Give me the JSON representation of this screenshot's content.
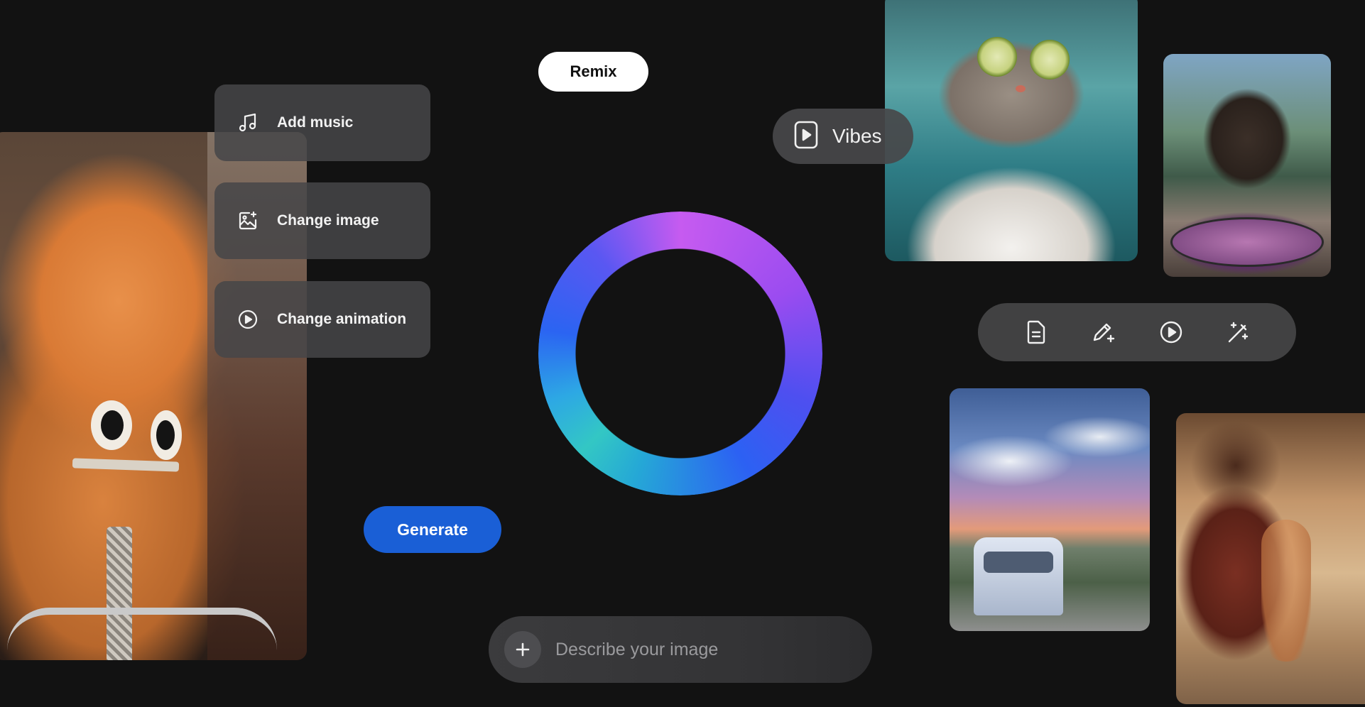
{
  "remix": {
    "label": "Remix"
  },
  "menu": {
    "items": [
      {
        "label": "Add music",
        "icon": "music-note-icon"
      },
      {
        "label": "Change image",
        "icon": "image-sparkle-icon"
      },
      {
        "label": "Change animation",
        "icon": "play-circle-icon"
      }
    ]
  },
  "vibes": {
    "label": "Vibes",
    "icon": "play-square-icon"
  },
  "generate": {
    "label": "Generate"
  },
  "toolbar": {
    "tools": [
      "document-icon",
      "pencil-sparkle-icon",
      "play-circle-icon",
      "magic-wand-icon"
    ]
  },
  "prompt": {
    "placeholder": "Describe your image",
    "add_icon": "plus-icon"
  },
  "colors": {
    "background": "#121212",
    "generate_button": "#1a5fd6",
    "ring_magenta": "#c65bf0",
    "ring_blue": "#2c61f3",
    "ring_teal": "#33c7c4"
  }
}
